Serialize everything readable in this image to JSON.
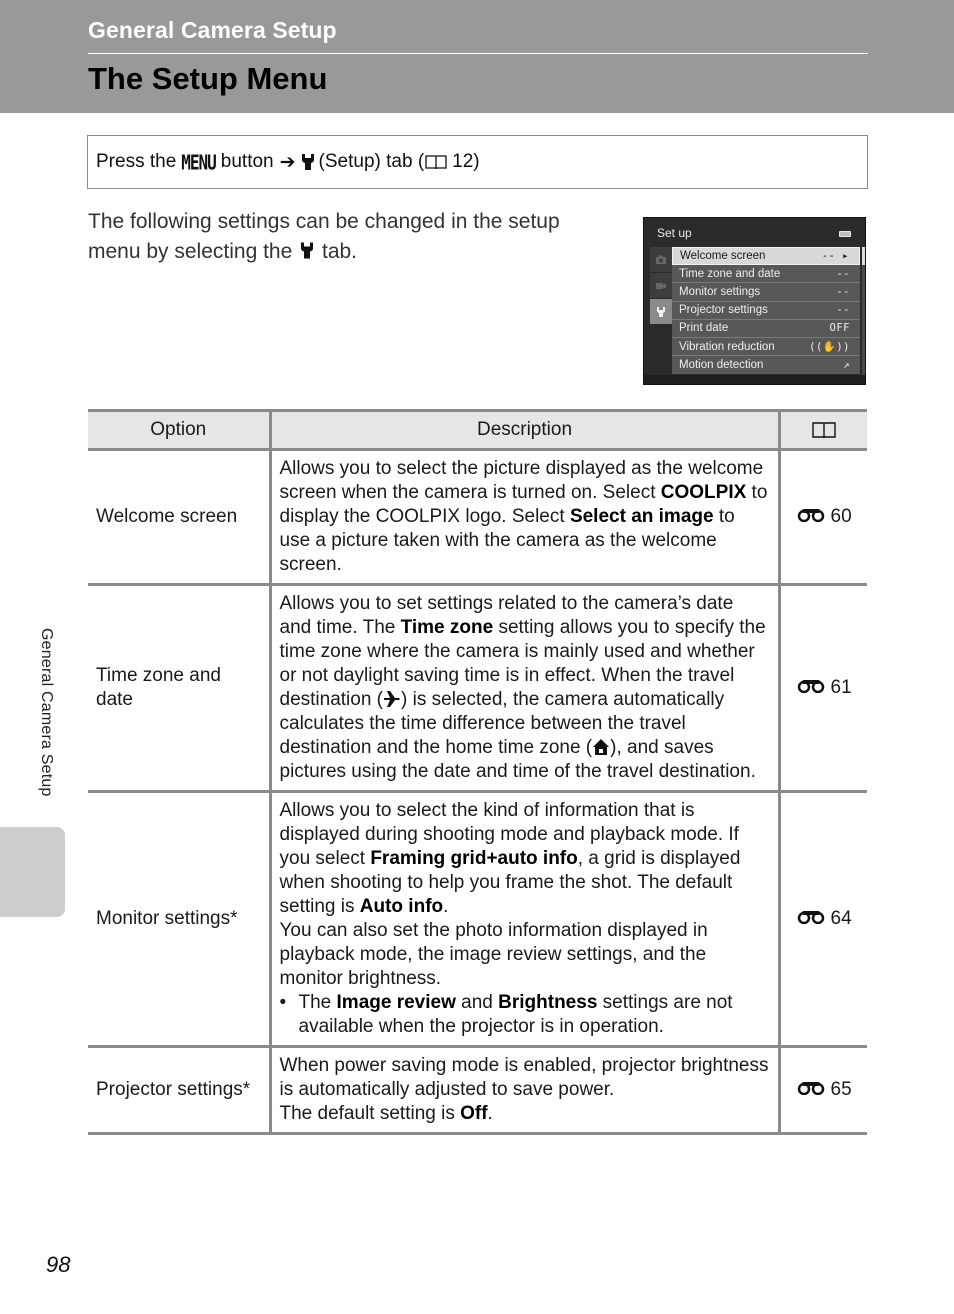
{
  "header": {
    "section_title": "General Camera Setup",
    "page_title": "The Setup Menu",
    "band_color": "#999999"
  },
  "navigation": {
    "prefix": "Press the",
    "menu_button": "MENU",
    "button_word": "button",
    "arrow": "➔",
    "tab_text": "(Setup) tab (",
    "page_ref": "12)",
    "icons": [
      "wrench-icon",
      "book-icon"
    ]
  },
  "intro": {
    "text_before": "The following settings can be changed in the setup menu by selecting the",
    "text_after": "tab."
  },
  "camera_screen": {
    "title": "Set up",
    "tabs": [
      {
        "icon": "camera-icon",
        "active": false
      },
      {
        "icon": "movie-icon",
        "active": false
      },
      {
        "icon": "wrench-icon",
        "active": true
      }
    ],
    "items": [
      {
        "label": "Welcome screen",
        "value": "-- ▸",
        "selected": true
      },
      {
        "label": "Time zone and date",
        "value": "--",
        "selected": false
      },
      {
        "label": "Monitor settings",
        "value": "--",
        "selected": false
      },
      {
        "label": "Projector settings",
        "value": "--",
        "selected": false
      },
      {
        "label": "Print date",
        "value": "OFF",
        "selected": false
      },
      {
        "label": "Vibration reduction",
        "value": "((✋))",
        "selected": false
      },
      {
        "label": "Motion detection",
        "value": "↗",
        "selected": false
      }
    ]
  },
  "table": {
    "headers": {
      "option": "Option",
      "description": "Description",
      "reference": "book-icon"
    },
    "rows": [
      {
        "option": "Welcome screen",
        "description": [
          {
            "t": "Allows you to select the picture displayed as the welcome screen when the camera is turned on. Select "
          },
          {
            "b": "COOLPIX"
          },
          {
            "t": " to display the COOLPIX logo. Select "
          },
          {
            "b": "Select an image"
          },
          {
            "t": " to use a picture taken with the camera as the welcome screen."
          }
        ],
        "ref_page": "60"
      },
      {
        "option": "Time zone and date",
        "description": [
          {
            "t": "Allows you to set settings related to the camera’s date and time. The "
          },
          {
            "b": "Time zone"
          },
          {
            "t": " setting allows you to specify the time zone where the camera is mainly used and whether or not daylight saving time is in effect. When the travel destination ("
          },
          {
            "icon": "airplane-icon"
          },
          {
            "t": ") is selected, the camera automatically calculates the time difference between the travel destination and the home time zone ("
          },
          {
            "icon": "home-icon"
          },
          {
            "t": "), and saves pictures using the date and time of the travel destination."
          }
        ],
        "ref_page": "61"
      },
      {
        "option": "Monitor settings*",
        "description": [
          {
            "t": "Allows you to select the kind of information that is displayed during shooting mode and playback mode. If you select "
          },
          {
            "b": "Framing grid+auto info"
          },
          {
            "t": ", a grid is displayed when shooting to help you frame the shot. The default setting is "
          },
          {
            "b": "Auto info"
          },
          {
            "t": "."
          },
          {
            "br": true
          },
          {
            "t": "You can also set the photo information displayed in playback mode, the image review settings, and the monitor brightness."
          }
        ],
        "bullet": [
          {
            "t": "The "
          },
          {
            "b": "Image review"
          },
          {
            "t": " and "
          },
          {
            "b": "Brightness"
          },
          {
            "t": " settings are not available when the projector is in operation."
          }
        ],
        "ref_page": "64"
      },
      {
        "option": "Projector settings*",
        "description": [
          {
            "t": "When power saving mode is enabled, projector brightness is automatically adjusted to save power."
          },
          {
            "br": true
          },
          {
            "t": "The default setting is "
          },
          {
            "b": "Off"
          },
          {
            "t": "."
          }
        ],
        "ref_page": "65"
      }
    ]
  },
  "side_tab": {
    "label": "General Camera Setup"
  },
  "page_number": "98"
}
